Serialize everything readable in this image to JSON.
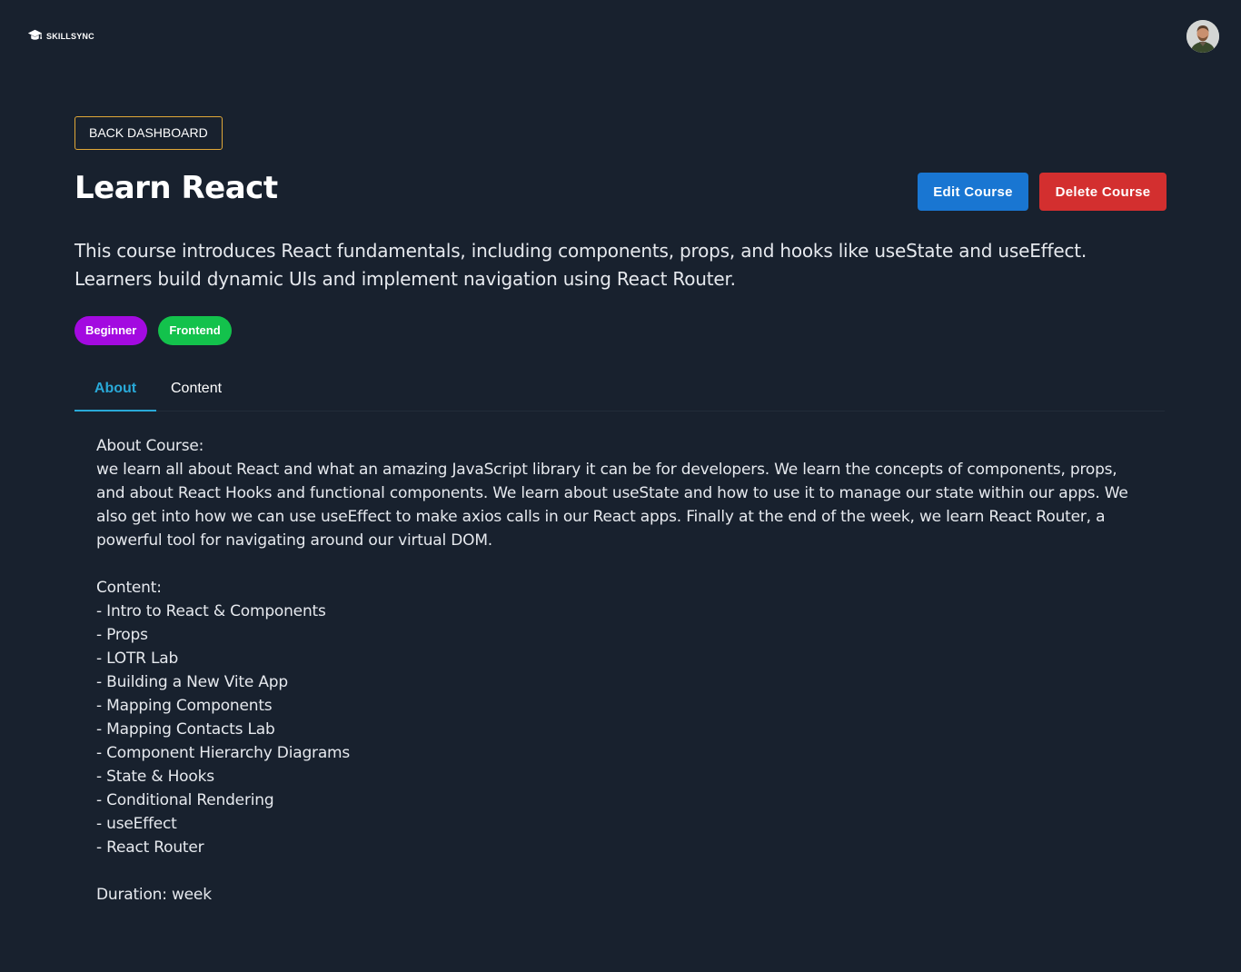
{
  "brand": {
    "name": "SKILLSYNC"
  },
  "header": {
    "avatar_icon": "user-avatar"
  },
  "nav": {
    "back_label": "BACK DASHBOARD"
  },
  "course": {
    "title": "Learn React",
    "summary": "This course introduces React fundamentals, including components, props, and hooks like useState and useEffect. Learners build dynamic UIs and implement navigation using React Router.",
    "tags": [
      {
        "label": "Beginner",
        "color": "#a30ae0"
      },
      {
        "label": "Frontend",
        "color": "#13c24c"
      }
    ]
  },
  "actions": {
    "edit_label": "Edit Course",
    "delete_label": "Delete Course",
    "edit_color": "#1976d2",
    "delete_color": "#d32f2f"
  },
  "tabs": [
    {
      "label": "About",
      "active": true
    },
    {
      "label": "Content",
      "active": false
    }
  ],
  "about": {
    "heading": "About Course:",
    "body": "we learn all about React and what an amazing JavaScript library it can be for developers. We learn the concepts of components, props, and about React Hooks and functional components. We learn about useState and how to use it to manage our state within our apps. We also get into how we can use useEffect to make axios calls in our React apps. Finally at the end of the week, we learn React Router, a powerful tool for navigating around our virtual DOM.",
    "content_heading": "Content:",
    "content_items": [
      "- Intro to React & Components",
      "- Props",
      "- LOTR Lab",
      "- Building a New Vite App",
      "- Mapping Components",
      "- Mapping Contacts Lab",
      "- Component Hierarchy Diagrams",
      "- State & Hooks",
      "- Conditional Rendering",
      "- useEffect",
      "- React Router"
    ],
    "duration": "Duration: week"
  },
  "colors": {
    "background": "#18212e",
    "accent": "#29a9d8",
    "back_border": "#e0a738"
  }
}
